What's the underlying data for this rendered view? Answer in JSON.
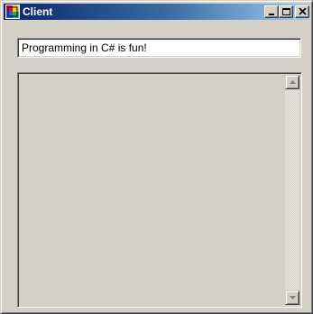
{
  "window": {
    "title": "Client",
    "icon": "app-window-icon",
    "controls": {
      "minimize_icon": "minimize-icon",
      "maximize_icon": "maximize-icon",
      "close_icon": "close-icon"
    },
    "colors": {
      "titlebar_start": "#0a246a",
      "titlebar_end": "#a6caf0",
      "face": "#d4d0c8"
    }
  },
  "message_input": {
    "value": "Programming in C# is fun!"
  },
  "display": {
    "scrollbar": {
      "up_icon": "scroll-up-arrow-icon",
      "down_icon": "scroll-down-arrow-icon"
    }
  }
}
